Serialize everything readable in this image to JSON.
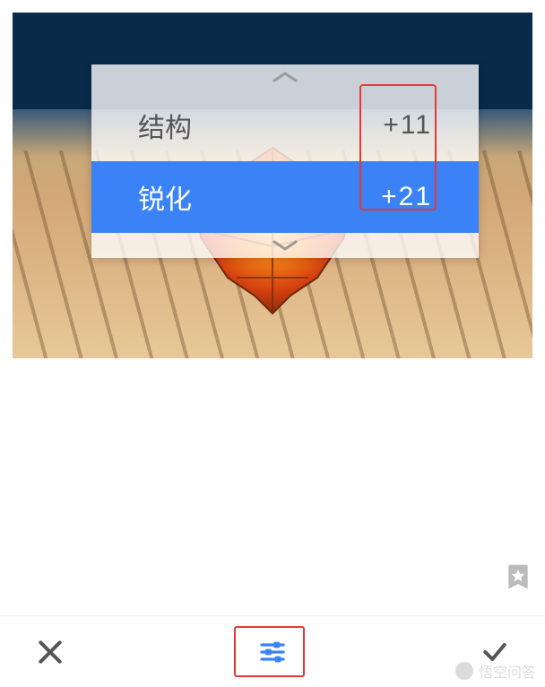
{
  "panel": {
    "rows": [
      {
        "label": "结构",
        "value": "+11",
        "active": false
      },
      {
        "label": "锐化",
        "value": "+21",
        "active": true
      }
    ]
  },
  "toolbar": {
    "cancel_icon": "close-icon",
    "adjust_icon": "tune-icon",
    "apply_icon": "check-icon"
  },
  "favorite_icon": "star-bookmark-icon",
  "watermark": {
    "text": "悟空问答"
  },
  "colors": {
    "accent": "#3b82f6",
    "highlight": "#e53935"
  }
}
